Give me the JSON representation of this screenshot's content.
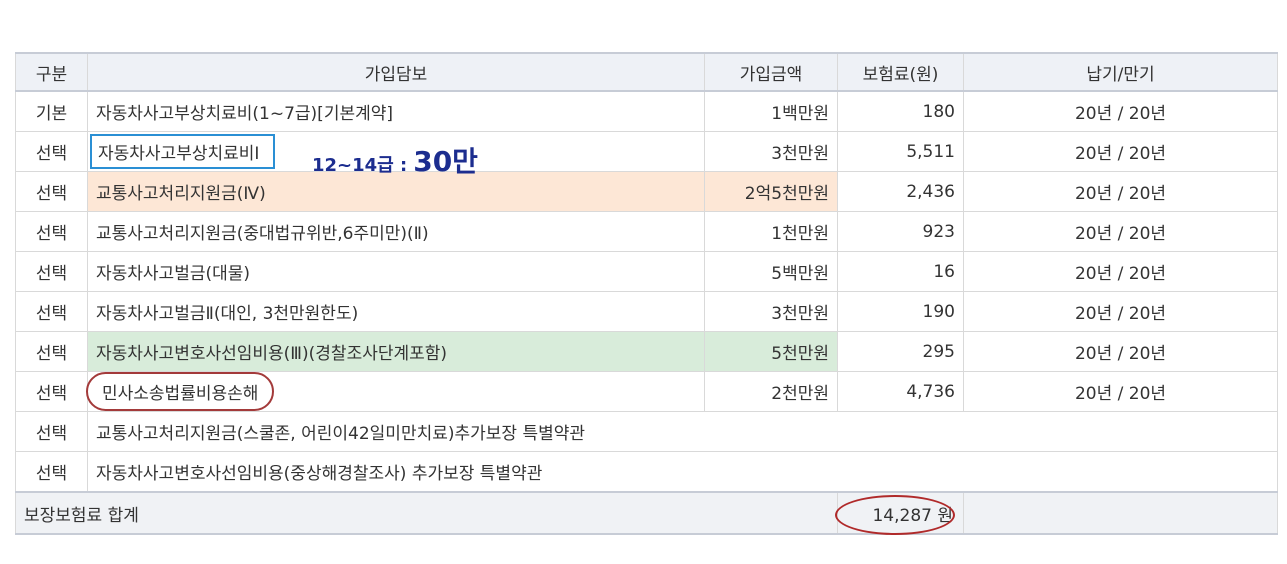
{
  "headers": {
    "category": "구분",
    "coverage": "가입담보",
    "amount": "가입금액",
    "premium": "보험료(원)",
    "period": "납기/만기"
  },
  "rows": [
    {
      "category": "기본",
      "coverage": "자동차사고부상치료비(1~7급)[기본계약]",
      "amount": "1백만원",
      "premium": "180",
      "period": "20년 / 20년"
    },
    {
      "category": "선택",
      "coverage": "자동차사고부상치료비I",
      "amount": "3천만원",
      "premium": "5,511",
      "period": "20년 / 20년"
    },
    {
      "category": "선택",
      "coverage": "교통사고처리지원금(Ⅳ)",
      "amount": "2억5천만원",
      "premium": "2,436",
      "period": "20년 / 20년"
    },
    {
      "category": "선택",
      "coverage": "교통사고처리지원금(중대법규위반,6주미만)(Ⅱ)",
      "amount": "1천만원",
      "premium": "923",
      "period": "20년 / 20년"
    },
    {
      "category": "선택",
      "coverage": "자동차사고벌금(대물)",
      "amount": "5백만원",
      "premium": "16",
      "period": "20년 / 20년"
    },
    {
      "category": "선택",
      "coverage": "자동차사고벌금Ⅱ(대인, 3천만원한도)",
      "amount": "3천만원",
      "premium": "190",
      "period": "20년 / 20년"
    },
    {
      "category": "선택",
      "coverage": "자동차사고변호사선임비용(Ⅲ)(경찰조사단계포함)",
      "amount": "5천만원",
      "premium": "295",
      "period": "20년 / 20년"
    },
    {
      "category": "선택",
      "coverage": "민사소송법률비용손해",
      "amount": "2천만원",
      "premium": "4,736",
      "period": "20년 / 20년"
    },
    {
      "category": "선택",
      "coverage": "교통사고처리지원금(스쿨존, 어린이42일미만치료)추가보장 특별약관",
      "amount": "",
      "premium": "",
      "period": ""
    },
    {
      "category": "선택",
      "coverage": "자동차사고변호사선임비용(중상해경찰조사) 추가보장 특별약관",
      "amount": "",
      "premium": "",
      "period": ""
    }
  ],
  "total": {
    "label": "보장보험료 합계",
    "amount": "14,287 원"
  },
  "annotation": {
    "grade": "12~14급 :",
    "value": "30만"
  },
  "colors": {
    "highlight_orange": "#fde7d6",
    "highlight_green": "#d8ecda",
    "annotation_blue": "#1c2d8f",
    "box_blue": "#2a8fd4",
    "oval_red": "#a33a3a"
  }
}
